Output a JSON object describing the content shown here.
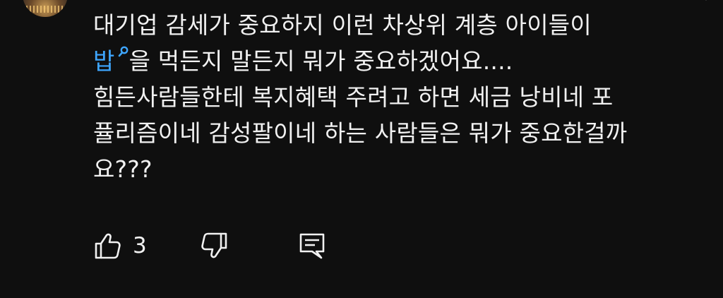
{
  "comment": {
    "lines": [
      {
        "text": "대기업 감세가 중요하지 이런 차상위 계층 아이들이"
      },
      {
        "link": "밥",
        "rest": "을 먹든지 말든지 뭐가 중요하겠어요...."
      },
      {
        "text": "힘든사람들한테 복지혜택 주려고 하면 세금 낭비네 포"
      },
      {
        "text": "퓰리즘이네 감성팔이네 하는 사람들은 뭐가 중요한걸까"
      },
      {
        "text": "요???"
      }
    ]
  },
  "actions": {
    "like_count": "3",
    "like_icon": "thumbs-up-icon",
    "dislike_icon": "thumbs-down-icon",
    "reply_icon": "comment-reply-icon"
  },
  "colors": {
    "background": "#0f0f0f",
    "text": "#f1f1f1",
    "link": "#3ea6ff"
  }
}
